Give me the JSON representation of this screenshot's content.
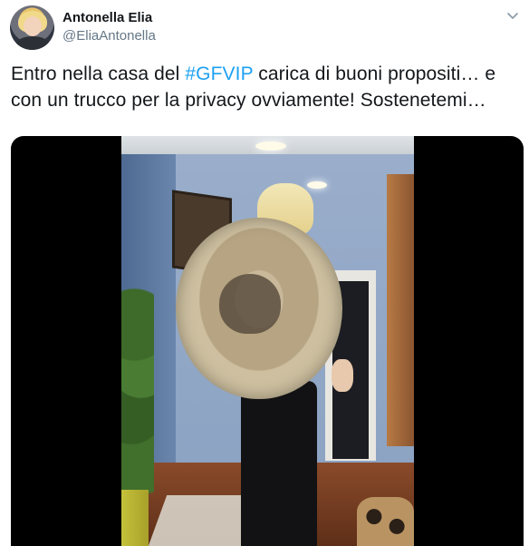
{
  "tweet": {
    "author": {
      "display_name": "Antonella Elia",
      "handle": "@EliaAntonella",
      "avatar_icon": "avatar-photo"
    },
    "text_before_hashtag": "Entro nella casa del ",
    "hashtag": "#GFVIP",
    "text_after_hashtag": " carica di buoni propositi… e con un trucco per la privacy ovviamente! Sostenetemi…",
    "menu_icon": "chevron-down-icon",
    "media": {
      "type": "video",
      "icon": "video-frame"
    }
  },
  "colors": {
    "link": "#1da1f2",
    "text_primary": "#14171a",
    "text_secondary": "#657786",
    "media_background": "#000000"
  }
}
